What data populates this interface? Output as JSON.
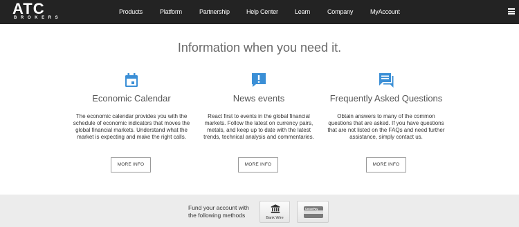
{
  "brand": {
    "name": "ATC",
    "sub": "BROKERS"
  },
  "nav": {
    "items": [
      {
        "label": "Products"
      },
      {
        "label": "Platform"
      },
      {
        "label": "Partnership"
      },
      {
        "label": "Help Center"
      },
      {
        "label": "Learn"
      },
      {
        "label": "Company"
      },
      {
        "label": "MyAccount"
      }
    ]
  },
  "headline": "Information when you need it.",
  "features": [
    {
      "icon": "calendar-icon",
      "title": "Economic Calendar",
      "text": "The economic calendar provides you with the schedule of economic indicators that moves the global financial markets. Understand what the market is expecting and make the right calls.",
      "button": "MORE INFO"
    },
    {
      "icon": "alert-icon",
      "title": "News events",
      "text": "React first to events in the global financial markets. Follow the latest on currency pairs, metals, and keep up to date with the latest trends, technical analysis and commentaries.",
      "button": "MORE INFO"
    },
    {
      "icon": "chat-icon",
      "title": "Frequently Asked Questions",
      "text": "Obtain answers to many of the common questions that are asked. If you have questions that are not listed on the FAQs and need further assistance, simply contact us.",
      "button": "MORE INFO"
    }
  ],
  "footer": {
    "fund_text": "Fund your account with the following methods",
    "methods": [
      {
        "icon": "bank-icon",
        "label": "Bank Wire"
      },
      {
        "icon": "unionpay-icon",
        "label": "UnionPay"
      }
    ]
  },
  "colors": {
    "nav_bg": "#232323",
    "icon_blue": "#3b8fd6",
    "footer_bg": "#ececec"
  }
}
